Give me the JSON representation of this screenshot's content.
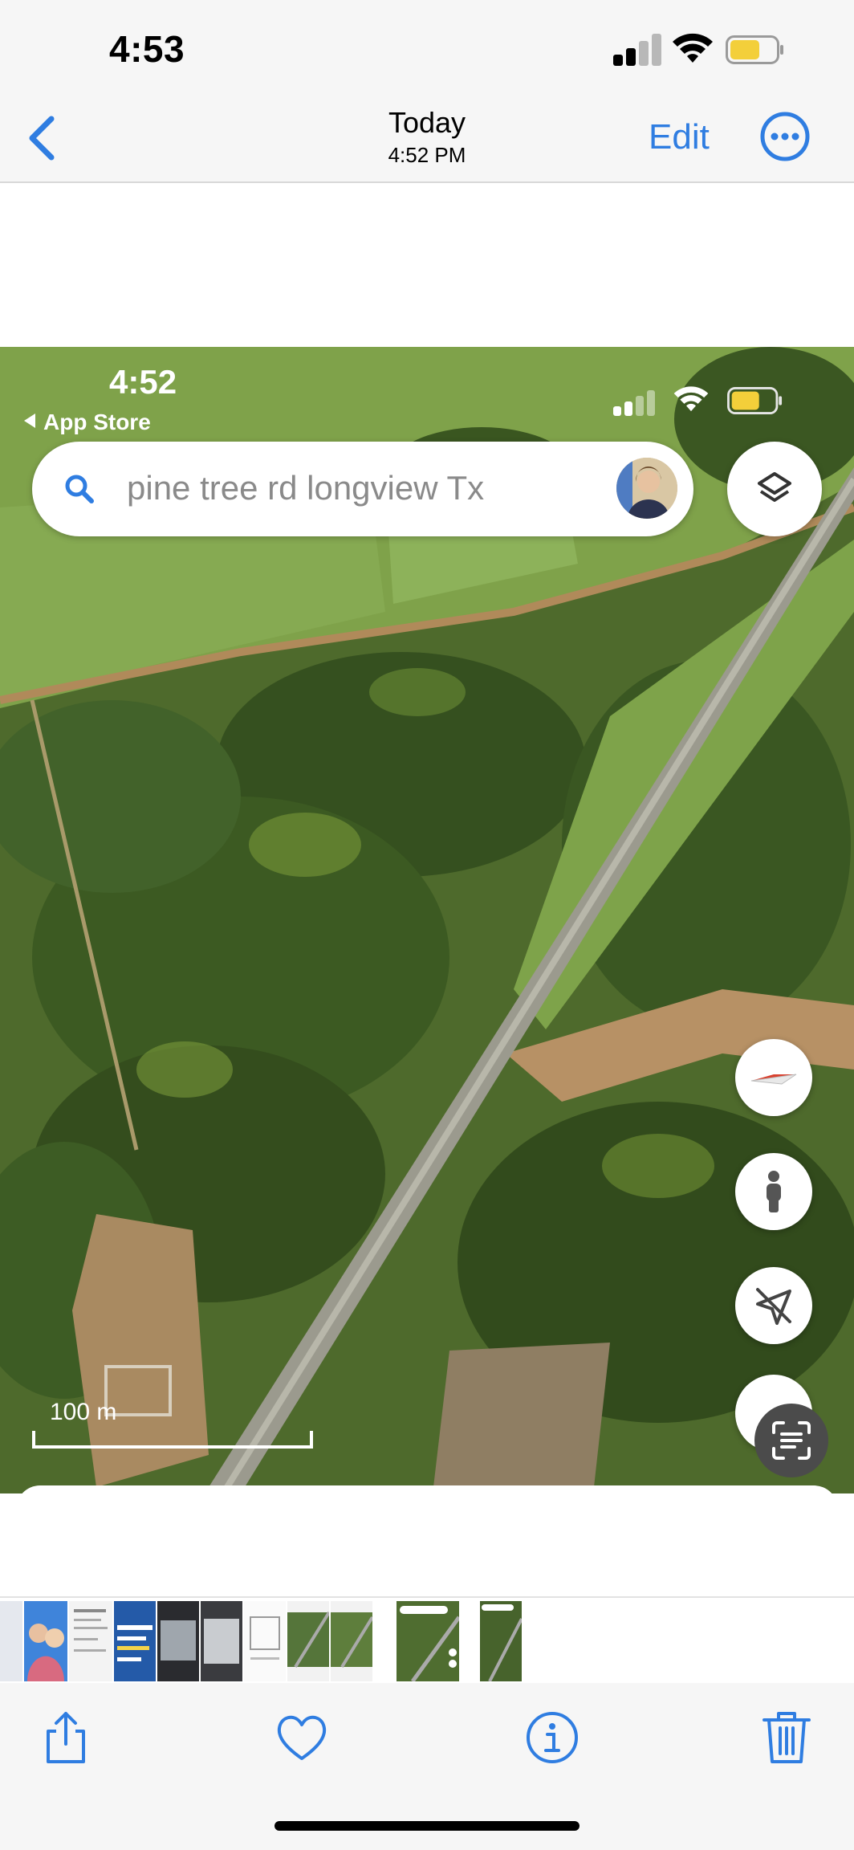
{
  "status_bar": {
    "time": "4:53",
    "signal_bars_filled": 2,
    "icons": [
      "cellular-signal-icon",
      "wifi-icon",
      "battery-icon"
    ],
    "battery_color": "#f3cf3a"
  },
  "nav_bar": {
    "title": "Today",
    "subtitle": "4:52 PM",
    "edit_label": "Edit",
    "accent_color": "#2f7de1"
  },
  "screenshot": {
    "time": "4:52",
    "back_app": "App Store",
    "search": {
      "query": "pine tree rd longview Tx"
    },
    "scale_label": "100 m",
    "buttons": [
      "layers-icon",
      "compass-icon",
      "street-view-pegman-icon",
      "location-off-icon",
      "live-text-scan-icon"
    ]
  },
  "thumbnail_strip": {
    "count": 11
  },
  "toolbar": {
    "icons": [
      "share-icon",
      "heart-icon",
      "info-icon",
      "trash-icon"
    ]
  }
}
